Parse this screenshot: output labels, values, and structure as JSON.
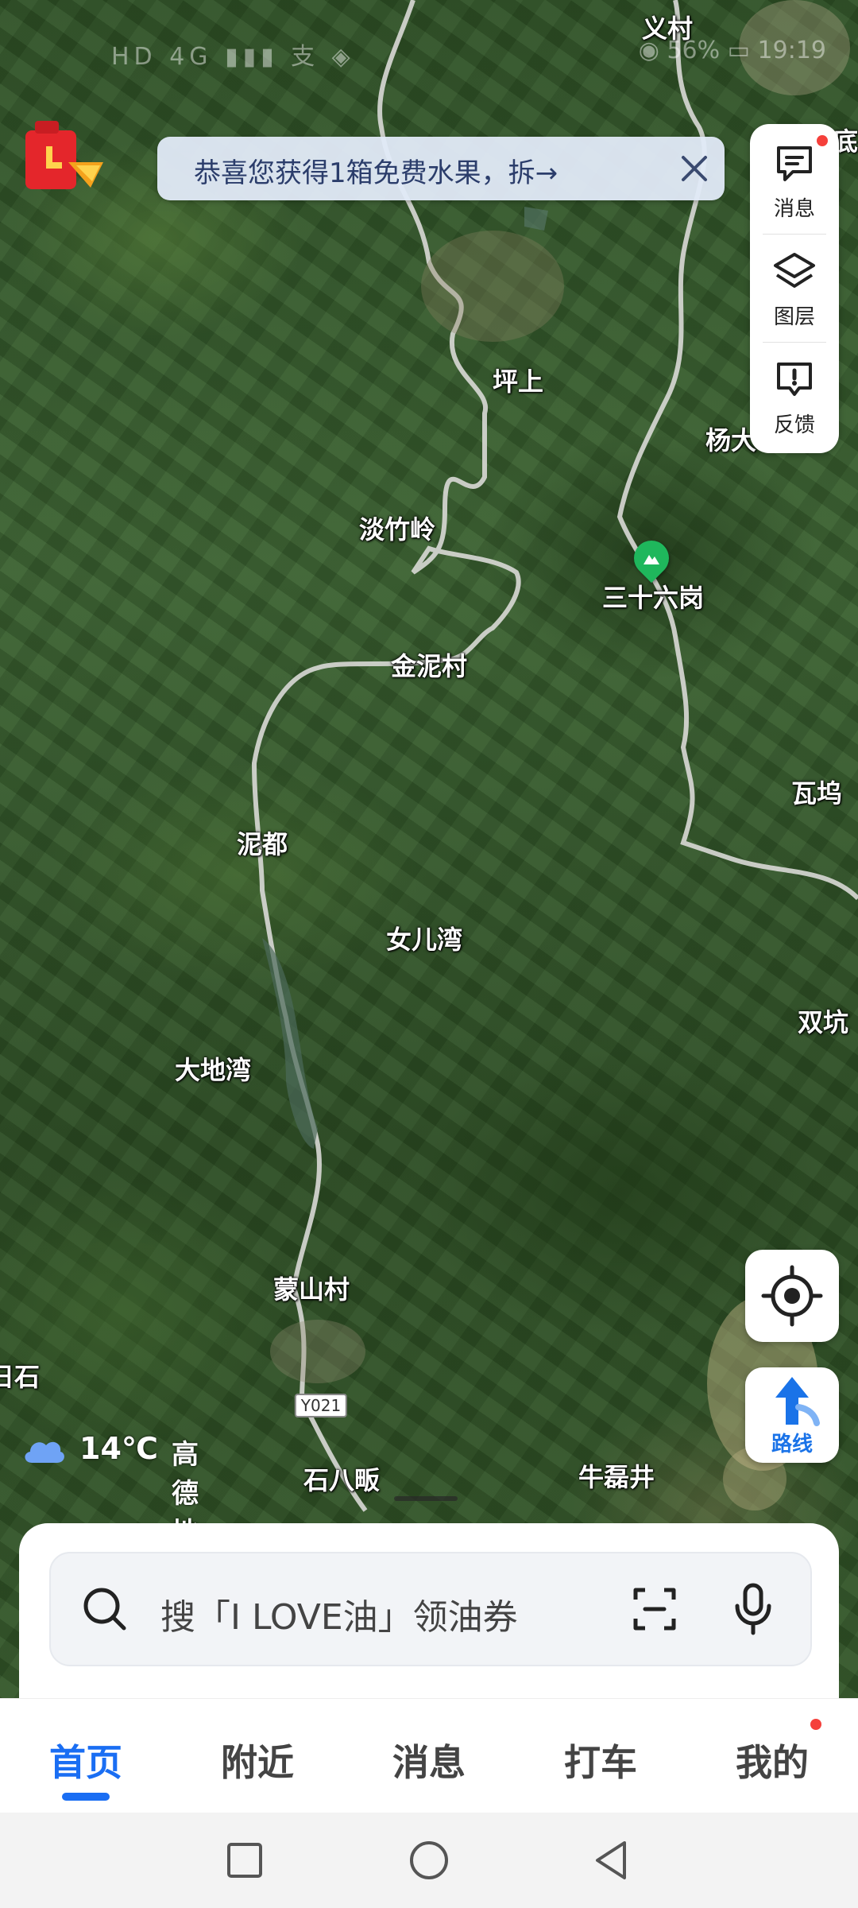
{
  "status_bar": {
    "left": "HD 4G ▮▮▮ 支 ◈",
    "right": "◉ 56% ▭ 19:19"
  },
  "banner": {
    "text": "恭喜您获得1箱免费水果，拆→"
  },
  "tools": [
    {
      "label": "消息",
      "icon": "message-icon"
    },
    {
      "label": "图层",
      "icon": "layers-icon"
    },
    {
      "label": "反馈",
      "icon": "feedback-icon"
    }
  ],
  "route": {
    "label": "路线"
  },
  "weather": {
    "temp": "14℃",
    "brand": "高德地图"
  },
  "search": {
    "placeholder": "搜「I LOVE油」领油券"
  },
  "tabs": [
    {
      "label": "首页",
      "active": true
    },
    {
      "label": "附近"
    },
    {
      "label": "消息"
    },
    {
      "label": "打车"
    },
    {
      "label": "我的"
    }
  ],
  "map": {
    "places": [
      "义村",
      "坪上",
      "杨大",
      "淡竹岭",
      "三十六岗",
      "金泥村",
      "瓦坞",
      "泥都",
      "女儿湾",
      "双坑",
      "大地湾",
      "蒙山村",
      "日石",
      "石八畈",
      "牛磊井",
      "底"
    ],
    "road_badge": "Y021",
    "poi": "三十六岗"
  }
}
